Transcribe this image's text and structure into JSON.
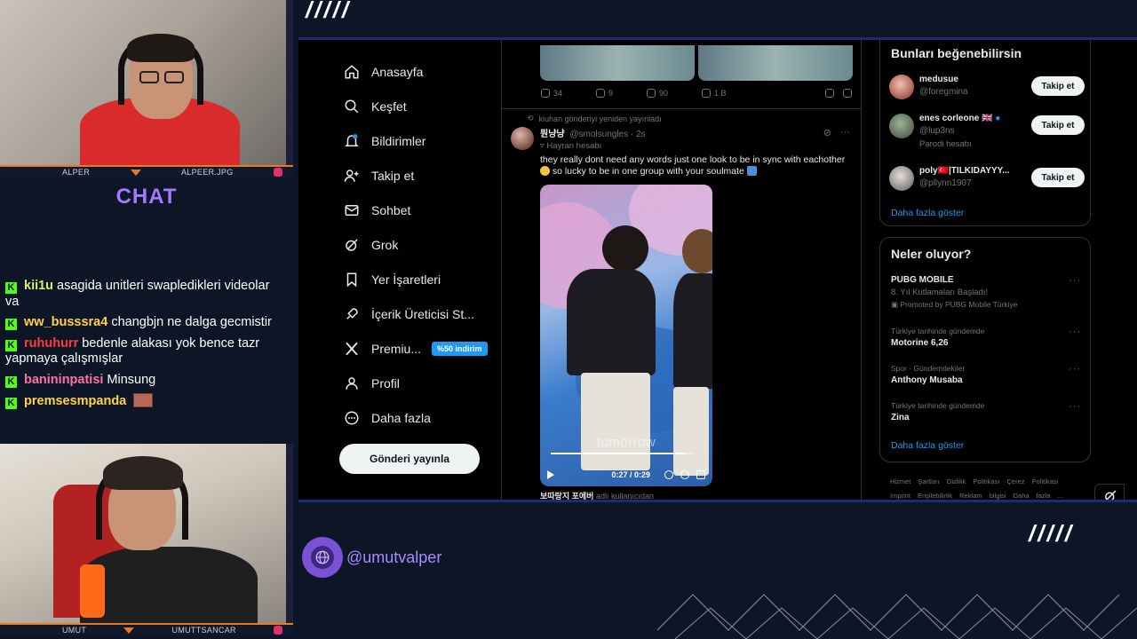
{
  "overlay": {
    "top_slashes": "/////",
    "top_cam": {
      "left_label": "ALPER",
      "right_label": "ALPEER.JPG"
    },
    "bottom_cam": {
      "left_label": "UMUT",
      "right_label": "UMUTTSANCAR"
    },
    "chat_title": "CHAT",
    "chat_messages": [
      {
        "user": "kii1u",
        "color": "#d8f26b",
        "text": "asagida unitleri swapledikleri videolar va"
      },
      {
        "user": "ww_busssra4",
        "color": "#ffd23f",
        "text": "changbjn ne dalga gecmistir"
      },
      {
        "user": "ruhuhurr",
        "color": "#ff3b3b",
        "text": "bedenle alakası yok bence tazr yapmaya çalışmışlar"
      },
      {
        "user": "banininpatisi",
        "color": "#ff6fa8",
        "text": "Minsung"
      },
      {
        "user": "premsesmpanda",
        "color": "#ffd23f",
        "text": ""
      }
    ],
    "handle": "@umutvalper",
    "bottom_slashes": "/////"
  },
  "nav": {
    "items": [
      {
        "label": "Anasayfa",
        "icon": "home-icon"
      },
      {
        "label": "Keşfet",
        "icon": "search-icon"
      },
      {
        "label": "Bildirimler",
        "icon": "bell-icon"
      },
      {
        "label": "Takip et",
        "icon": "person-add-icon"
      },
      {
        "label": "Sohbet",
        "icon": "mail-icon"
      },
      {
        "label": "Grok",
        "icon": "grok-icon"
      },
      {
        "label": "Yer İşaretleri",
        "icon": "bookmark-icon"
      },
      {
        "label": "İçerik Üreticisi St...",
        "icon": "rocket-icon"
      },
      {
        "label": "Premiu...",
        "icon": "x-logo-icon",
        "badge": "%50 indirim"
      },
      {
        "label": "Profil",
        "icon": "profile-icon"
      },
      {
        "label": "Daha fazla",
        "icon": "more-circle-icon"
      }
    ],
    "post_button": "Gönderi yayınla"
  },
  "feed": {
    "prev_actions": {
      "replies": "34",
      "reposts": "9",
      "likes": "90",
      "views": "1 B"
    },
    "repost_line": "kiuhan gönderiyi yeniden yayınladı",
    "tweet": {
      "name": "뭔냥냥",
      "handle": "@smolsungles",
      "time": "2s",
      "fan_label": "Hayran hesabı",
      "text": "they really dont need any words just one look to be in sync with eachother",
      "text2": "so lucky to be in one group with your soulmate",
      "video": {
        "watermark": "tomorrow",
        "time": "0:27 / 0:29",
        "progress": 0.93
      },
      "footer_name": "보따랑지 포에버",
      "footer_suffix": "adlı kullanıcıdan"
    }
  },
  "sidebar": {
    "suggest_title": "Bunları beğenebilirsin",
    "suggestions": [
      {
        "name": "medusue",
        "handle": "@foregmina",
        "extra": ""
      },
      {
        "name": "enes corleone 🇬🇧",
        "handle": "@lup3ns",
        "extra": "Parodi hesabı"
      },
      {
        "name": "poly🇹🇷|TILKIDAYYY...",
        "handle": "@pllynn1907",
        "extra": ""
      }
    ],
    "follow_label": "Takip et",
    "show_more": "Daha fazla göster",
    "trends_title": "Neler oluyor?",
    "trends": [
      {
        "cat": "",
        "title": "PUBG MOBILE",
        "sub": "8. Yıl Kutlamaları Başladı!",
        "promo": "Promoted by PUBG Mobile Türkiye"
      },
      {
        "cat": "Türkiye tarihinde gündemde",
        "title": "Motorine 6,26"
      },
      {
        "cat": "Spor · Gündemdekiler",
        "title": "Anthony Musaba"
      },
      {
        "cat": "Türkiye tarihinde gündemde",
        "title": "Zina"
      }
    ],
    "trends_more": "Daha fazla göster",
    "footer_links": "Hizmet Şartları  Gizlilik Politikası  Çerez Politikası  Imprint  Erişilebilirlik  Reklam bilgisi  Daha fazla ..."
  }
}
